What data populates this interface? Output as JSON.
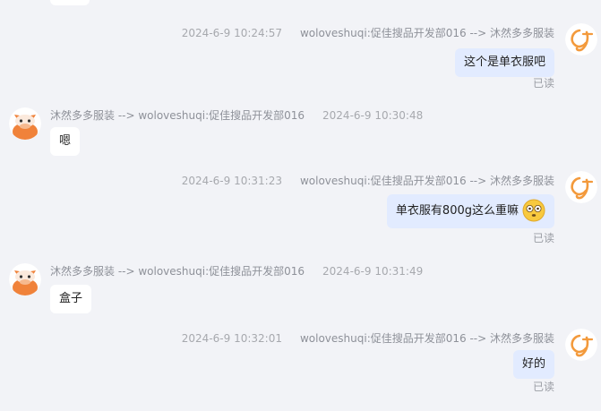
{
  "messages": [
    {
      "direction": "out",
      "time": "2024-6-9 10:24:57",
      "route": "woloveshuqi:促佳搜品开发部016 --> 沐然多多服装",
      "text": "这个是单衣服吧",
      "status": "已读"
    },
    {
      "direction": "in",
      "route": "沐然多多服装 --> woloveshuqi:促佳搜品开发部016",
      "time": "2024-6-9 10:30:48",
      "text": "嗯"
    },
    {
      "direction": "out",
      "time": "2024-6-9 10:31:23",
      "route": "woloveshuqi:促佳搜品开发部016 --> 沐然多多服装",
      "text": "单衣服有800g这么重嘛",
      "emoji": "flushed-face-emoji",
      "status": "已读"
    },
    {
      "direction": "in",
      "route": "沐然多多服装 --> woloveshuqi:促佳搜品开发部016",
      "time": "2024-6-9 10:31:49",
      "text": "盒子"
    },
    {
      "direction": "out",
      "time": "2024-6-9 10:32:01",
      "route": "woloveshuqi:促佳搜品开发部016 --> 沐然多多服装",
      "text": "好的",
      "status": "已读"
    }
  ],
  "avatars": {
    "self": "brand-logo-avatar",
    "other": "cow-face-avatar"
  },
  "colors": {
    "background": "#f2f3f7",
    "outgoing_bubble": "#e2ebff",
    "incoming_bubble": "#ffffff",
    "logo_orange": "#f39a3c",
    "cow_orange": "#f0823a"
  }
}
